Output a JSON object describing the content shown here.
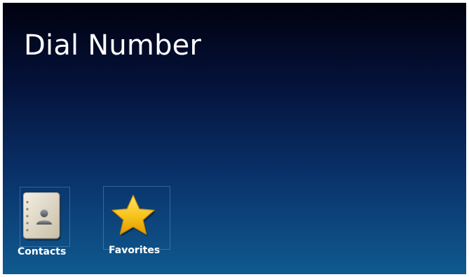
{
  "screen": {
    "title": "Dial Number"
  },
  "tiles": [
    {
      "label": "Contacts",
      "icon": "address-book-icon"
    },
    {
      "label": "Favorites",
      "icon": "star-icon"
    }
  ],
  "colors": {
    "background_top": "#01010f",
    "background_bottom": "#0f5a8f",
    "text": "#ffffff",
    "star": "#f7c21a"
  }
}
